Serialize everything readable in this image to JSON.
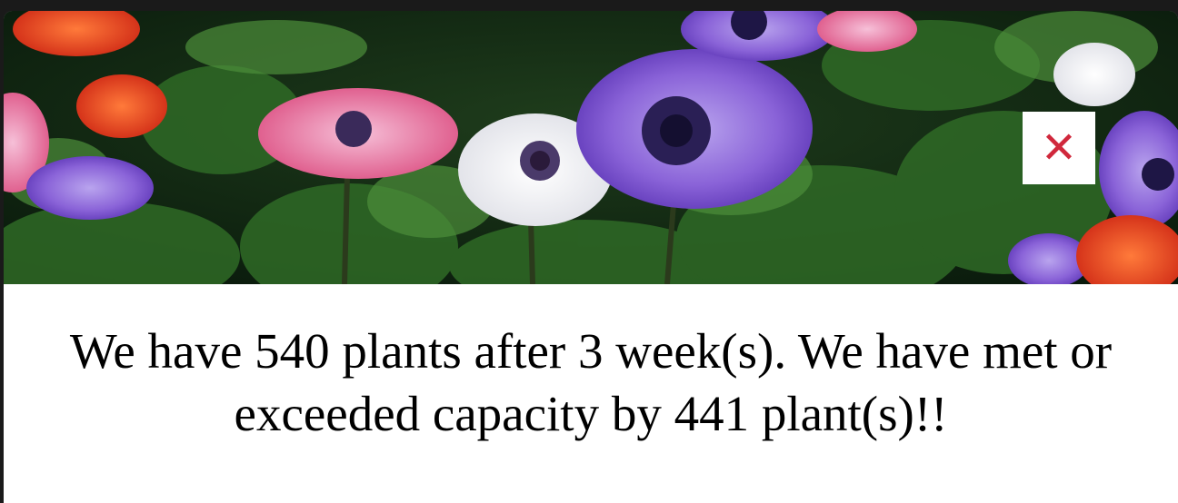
{
  "modal": {
    "hero_image": {
      "subject": "anemone flowers"
    },
    "close_button": {
      "glyph": "✕",
      "icon": "close-icon",
      "color": "#d0283c"
    },
    "message": "We have 540 plants after 3 week(s). We have met or exceeded capacity by 441 plant(s)!!"
  }
}
